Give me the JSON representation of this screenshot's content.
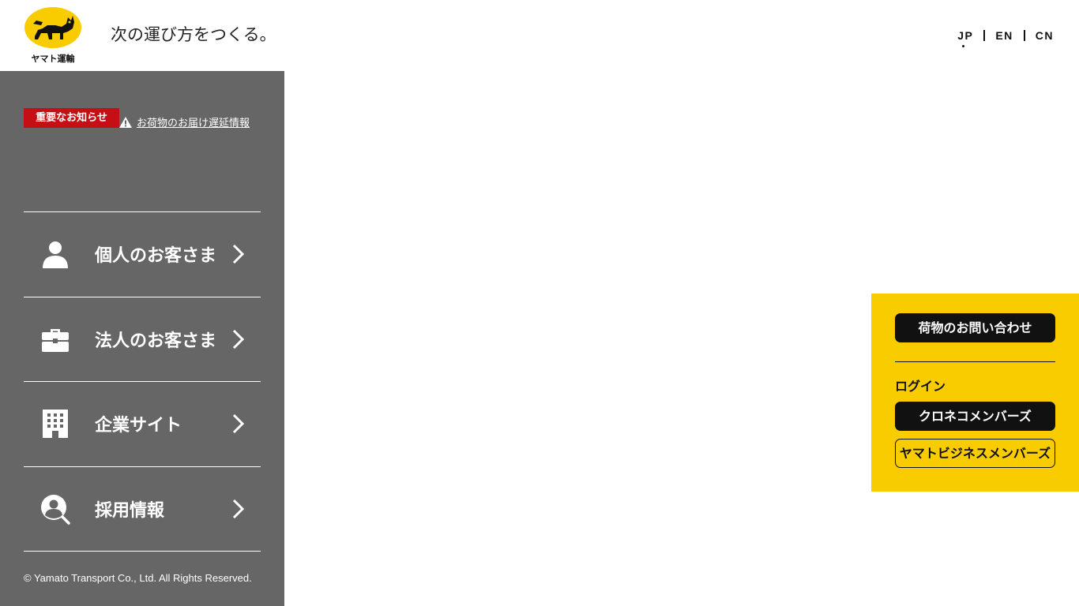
{
  "header": {
    "logo_text": "ヤマト運輸",
    "tagline": "次の運び方をつくる。",
    "languages": [
      {
        "label": "JP",
        "active": true
      },
      {
        "label": "EN",
        "active": false
      },
      {
        "label": "CN",
        "active": false
      }
    ]
  },
  "sidebar": {
    "notice": {
      "badge": "重要なお知らせ",
      "link_text": "お荷物のお届け遅延情報",
      "icon": "warning-icon"
    },
    "menu": [
      {
        "label": "個人のお客さま",
        "icon": "person-icon"
      },
      {
        "label": "法人のお客さま",
        "icon": "briefcase-icon"
      },
      {
        "label": "企業サイト",
        "icon": "building-icon"
      },
      {
        "label": "採用情報",
        "icon": "recruit-search-icon"
      }
    ],
    "copyright": "© Yamato Transport Co., Ltd. All Rights Reserved."
  },
  "panel": {
    "tracking_button": "荷物のお問い合わせ",
    "login_label": "ログイン",
    "kuroneko_button": "クロネコメンバーズ",
    "business_button": "ヤマトビジネスメンバーズ"
  },
  "colors": {
    "sidebar_bg": "#666666",
    "notice_red": "#c50f14",
    "panel_yellow": "#f9cc00",
    "dark_button": "#111111"
  }
}
